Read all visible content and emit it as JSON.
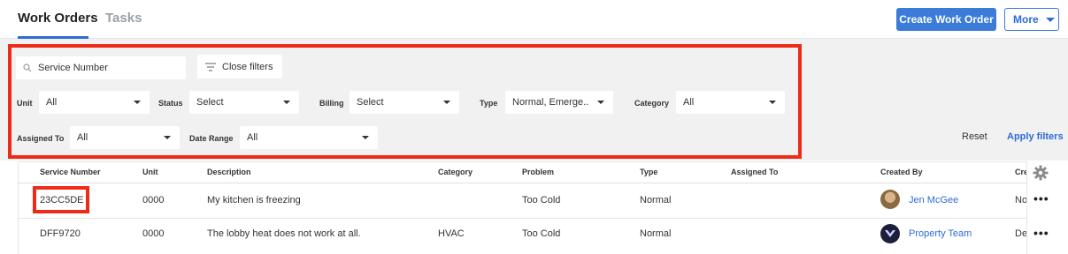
{
  "header": {
    "tabs": [
      {
        "label": "Work Orders",
        "active": true
      },
      {
        "label": "Tasks",
        "active": false
      }
    ],
    "create_button": "Create Work Order",
    "more_button": "More"
  },
  "filters": {
    "search_placeholder": "Service Number",
    "close_filters": "Close filters",
    "unit": {
      "label": "Unit",
      "value": "All"
    },
    "status": {
      "label": "Status",
      "value": "Select"
    },
    "billing": {
      "label": "Billing",
      "value": "Select"
    },
    "type": {
      "label": "Type",
      "value": "Normal, Emerge..."
    },
    "category": {
      "label": "Category",
      "value": "All"
    },
    "assigned_to": {
      "label": "Assigned To",
      "value": "All"
    },
    "date_range": {
      "label": "Date Range",
      "value": "All"
    },
    "reset": "Reset",
    "apply": "Apply filters"
  },
  "table": {
    "columns": [
      "Service Number",
      "Unit",
      "Description",
      "Category",
      "Problem",
      "Type",
      "Assigned To",
      "Created By",
      "Cre"
    ],
    "rows": [
      {
        "service_number": "23CC5DE",
        "unit": "0000",
        "description": "My kitchen is freezing",
        "category": "",
        "problem": "Too Cold",
        "type": "Normal",
        "assigned_to": "",
        "created_by": "Jen McGee",
        "extra": "No"
      },
      {
        "service_number": "DFF9720",
        "unit": "0000",
        "description": "The lobby heat does not work at all.",
        "category": "HVAC",
        "problem": "Too Cold",
        "type": "Normal",
        "assigned_to": "",
        "created_by": "Property Team",
        "extra": "De"
      }
    ]
  },
  "colors": {
    "accent": "#3b7bd9",
    "highlight": "#ee2b19",
    "filter_bg": "#f1f1f1"
  }
}
